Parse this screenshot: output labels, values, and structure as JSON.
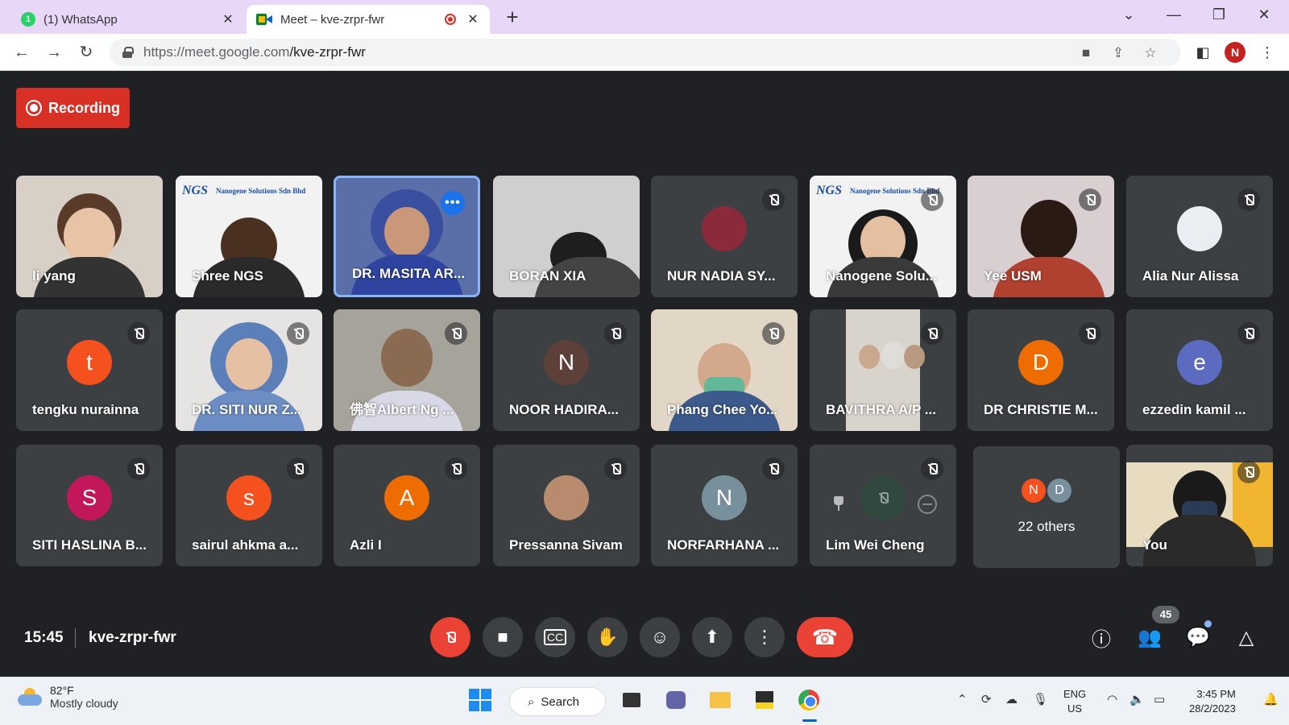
{
  "browser": {
    "tabs": [
      {
        "title": "(1) WhatsApp",
        "badge": "1"
      },
      {
        "title": "Meet – kve-zrpr-fwr"
      }
    ],
    "url_host": "https://meet.google.com",
    "url_path": "/kve-zrpr-fwr",
    "profile_initial": "N"
  },
  "meet": {
    "recording_label": "Recording",
    "time": "15:45",
    "meeting_code": "kve-zrpr-fwr",
    "participant_count": "45",
    "tiles": [
      {
        "name": "li yang"
      },
      {
        "name": "Shree NGS"
      },
      {
        "name": "DR. MASITA AR..."
      },
      {
        "name": "BORAN XIA"
      },
      {
        "name": "NUR NADIA SY..."
      },
      {
        "name": "Nanogene Solu..."
      },
      {
        "name": "Yee USM"
      },
      {
        "name": "Alia Nur Alissa"
      },
      {
        "name": "tengku nurainna",
        "initial": "t"
      },
      {
        "name": "DR. SITI NUR Z..."
      },
      {
        "name": "佛智Albert Ng ..."
      },
      {
        "name": "NOOR HADIRA...",
        "initial": "N"
      },
      {
        "name": "Phang Chee Yo..."
      },
      {
        "name": "BAVITHRA A/P ..."
      },
      {
        "name": "DR CHRISTIE M...",
        "initial": "D"
      },
      {
        "name": "ezzedin kamil ...",
        "initial": "e"
      },
      {
        "name": "SITI HASLINA B...",
        "initial": "S"
      },
      {
        "name": "sairul ahkma a...",
        "initial": "s"
      },
      {
        "name": "Azli I",
        "initial": "A"
      },
      {
        "name": "Pressanna Sivam"
      },
      {
        "name": "NORFARHANA ...",
        "initial": "N"
      },
      {
        "name": "Lim Wei Cheng"
      },
      {
        "name": "You"
      }
    ],
    "others": {
      "label": "22 others",
      "initials": [
        "N",
        "D"
      ]
    },
    "logo_text": "NGS",
    "logo_sub": "Nanogene Solutions Sdn Bhd"
  },
  "taskbar": {
    "temp": "82°F",
    "weather": "Mostly cloudy",
    "search_label": "Search",
    "lang_line1": "ENG",
    "lang_line2": "US",
    "clock_time": "3:45 PM",
    "clock_date": "28/2/2023"
  },
  "colors": {
    "meet_bg": "#202124",
    "tile_bg": "#3c4043",
    "record_red": "#d93025",
    "tab_bar": "#e8d7f7"
  }
}
